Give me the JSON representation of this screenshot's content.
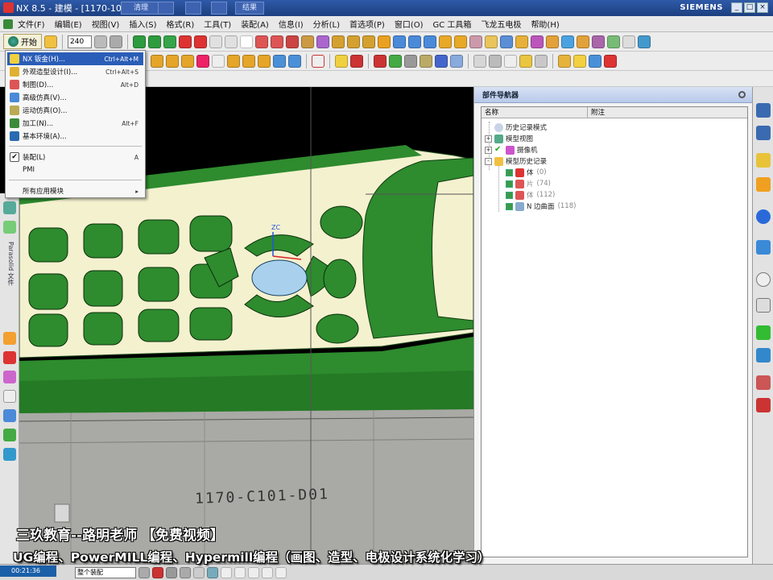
{
  "window": {
    "title": "NX 8.5 - 建模 - [1170-101-01",
    "brand": "SIEMENS",
    "mini_buttons": [
      "清理",
      "",
      "",
      "",
      "结果"
    ],
    "win_controls": [
      "_",
      "□",
      "×"
    ]
  },
  "menubar": {
    "items": [
      "文件(F)",
      "编辑(E)",
      "视图(V)",
      "插入(S)",
      "格式(R)",
      "工具(T)",
      "装配(A)",
      "信息(I)",
      "分析(L)",
      "首选项(P)",
      "窗口(O)",
      "GC 工具箱",
      "飞龙五电极",
      "帮助(H)"
    ]
  },
  "toolbar": {
    "start_label": "开始",
    "size_value": "240"
  },
  "start_menu": {
    "items": [
      {
        "label": "NX 钣金(H)...",
        "shortcut": "Ctrl+Alt+M",
        "active": true
      },
      {
        "label": "外观造型设计(I)...",
        "shortcut": "Ctrl+Alt+S"
      },
      {
        "label": "制图(D)...",
        "shortcut": "Alt+D"
      },
      {
        "label": "高级仿真(V)...",
        "shortcut": ""
      },
      {
        "label": "运动仿真(O)...",
        "shortcut": ""
      },
      {
        "label": "加工(N)...",
        "shortcut": "Alt+F"
      },
      {
        "label": "基本环境(A)...",
        "shortcut": ""
      },
      {
        "label": "装配(L)",
        "shortcut": "A"
      },
      {
        "label": "PMI",
        "shortcut": ""
      },
      {
        "label": "所有应用模块",
        "shortcut": "▸"
      }
    ]
  },
  "left_bar": {
    "vertical_label": "Parasolid 文件"
  },
  "viewport": {
    "part_engraving": "1170-C101-D01",
    "axis_label": "ZC"
  },
  "navigator": {
    "title": "部件导航器",
    "columns": [
      "名称",
      "附注"
    ],
    "rows": [
      {
        "label": "历史记录模式",
        "level": 0,
        "toggle": "",
        "count": ""
      },
      {
        "label": "模型视图",
        "level": 0,
        "toggle": "+",
        "count": ""
      },
      {
        "label": "摄像机",
        "level": 0,
        "toggle": "+",
        "count": ""
      },
      {
        "label": "模型历史记录",
        "level": 0,
        "toggle": "-",
        "count": ""
      },
      {
        "label": "体",
        "level": 1,
        "toggle": "",
        "count": "(0)"
      },
      {
        "label": "片",
        "level": 1,
        "toggle": "",
        "count": "(74)"
      },
      {
        "label": "体",
        "level": 1,
        "toggle": "",
        "count": "(112)"
      },
      {
        "label": "N 边曲面",
        "level": 1,
        "toggle": "",
        "count": "(118)"
      }
    ]
  },
  "status": {
    "timer": "00:21:36",
    "filter": "整个装配"
  },
  "overlay": {
    "line1": "三玖教育--路明老师   【免费视频】",
    "line2": "UG编程、PowerMILL编程、Hypermill编程（画图、造型、电极设计系统化学习）"
  },
  "colors": {
    "part_green": "#2e8b2e",
    "part_cream": "#f4f1cf",
    "part_gray": "#a9a9a6",
    "accent_blue": "#2a5db7"
  }
}
